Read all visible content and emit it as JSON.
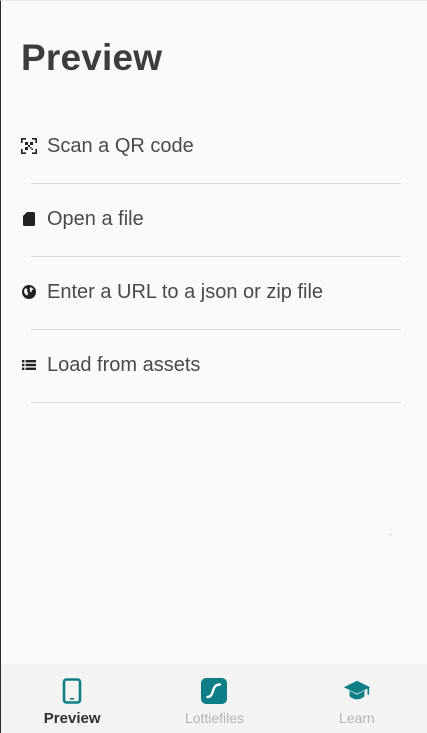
{
  "page": {
    "title": "Preview"
  },
  "menu": {
    "items": [
      {
        "label": "Scan a QR code",
        "icon": "qr-code-icon"
      },
      {
        "label": "Open a file",
        "icon": "sd-card-icon"
      },
      {
        "label": "Enter a URL to a json or zip file",
        "icon": "globe-icon"
      },
      {
        "label": "Load from assets",
        "icon": "list-icon"
      }
    ]
  },
  "bottom_nav": {
    "items": [
      {
        "label": "Preview",
        "icon": "phone-icon",
        "active": true
      },
      {
        "label": "Lottiefiles",
        "icon": "lottiefiles-icon",
        "active": false
      },
      {
        "label": "Learn",
        "icon": "graduation-cap-icon",
        "active": false
      }
    ]
  },
  "colors": {
    "accent": "#0e7f87",
    "title_text": "#3d3d3d",
    "body_text": "#4a4a4a",
    "inactive_nav_text": "#b5b5b5",
    "divider": "#d9d9d9"
  }
}
